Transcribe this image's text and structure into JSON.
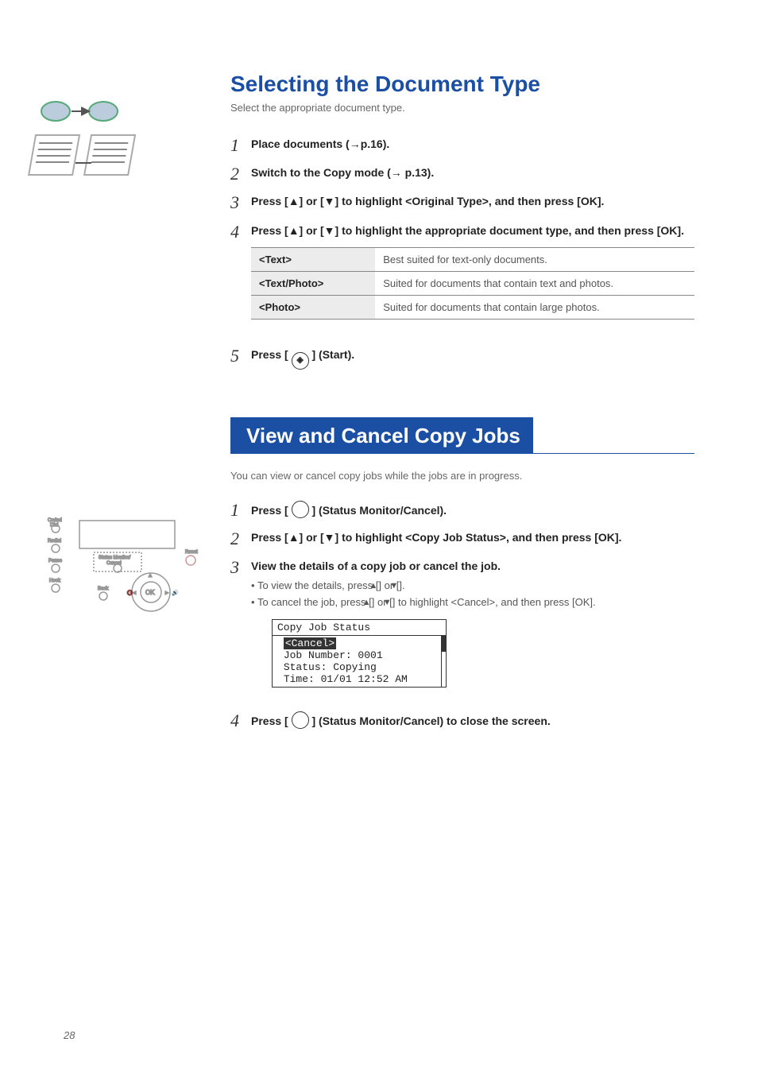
{
  "section1": {
    "heading": "Selecting the Document Type",
    "intro": "Select the appropriate document type.",
    "steps": [
      {
        "num": "1",
        "title": "Place documents (→p.16)."
      },
      {
        "num": "2",
        "title": "Switch to the Copy mode (→ p.13)."
      },
      {
        "num": "3",
        "title": "Press [▲] or [▼] to highlight <Original Type>, and then press [OK]."
      },
      {
        "num": "4",
        "title": "Press [▲] or [▼] to highlight the appropriate document type, and then press [OK]."
      }
    ],
    "table": [
      {
        "k": "<Text>",
        "v": "Best suited for text-only documents."
      },
      {
        "k": "<Text/Photo>",
        "v": "Suited for documents that contain text and photos."
      },
      {
        "k": "<Photo>",
        "v": "Suited for documents that contain large photos."
      }
    ],
    "step5": {
      "num": "5",
      "pre": "Press [ ",
      "post": " ] (Start)."
    }
  },
  "section2": {
    "banner": "View and Cancel Copy Jobs",
    "lead": "You can view or cancel copy jobs while the jobs are in progress.",
    "steps": {
      "s1": {
        "num": "1",
        "pre": "Press [ ",
        "post": " ] (Status Monitor/Cancel)."
      },
      "s2": {
        "num": "2",
        "title": "Press [▲] or [▼] to highlight <Copy Job Status>, and then press [OK]."
      },
      "s3": {
        "num": "3",
        "title": "View the details of a copy job or cancel the job.",
        "sub1_pre": "To view the details, press [",
        "sub1_mid": "] or [",
        "sub1_post": "].",
        "sub2_pre": "To cancel the job, press [",
        "sub2_mid1": "] or [",
        "sub2_mid2": "] to highlight <",
        "sub2_cancel": "Cancel",
        "sub2_mid3": ">, and then press [",
        "sub2_ok": "OK",
        "sub2_post": "]."
      },
      "s4": {
        "num": "4",
        "pre": "Press [ ",
        "post": " ] (Status Monitor/Cancel) to close the screen."
      }
    },
    "lcd": {
      "title": "Copy Job Status",
      "l1": "<Cancel>",
      "l2": "Job Number: 0001",
      "l3": "Status: Copying",
      "l4": "Time: 01/01 12:52 AM"
    }
  },
  "glyphs": {
    "up": "▲",
    "down": "▼",
    "start": "◈"
  },
  "pagenum": "28"
}
